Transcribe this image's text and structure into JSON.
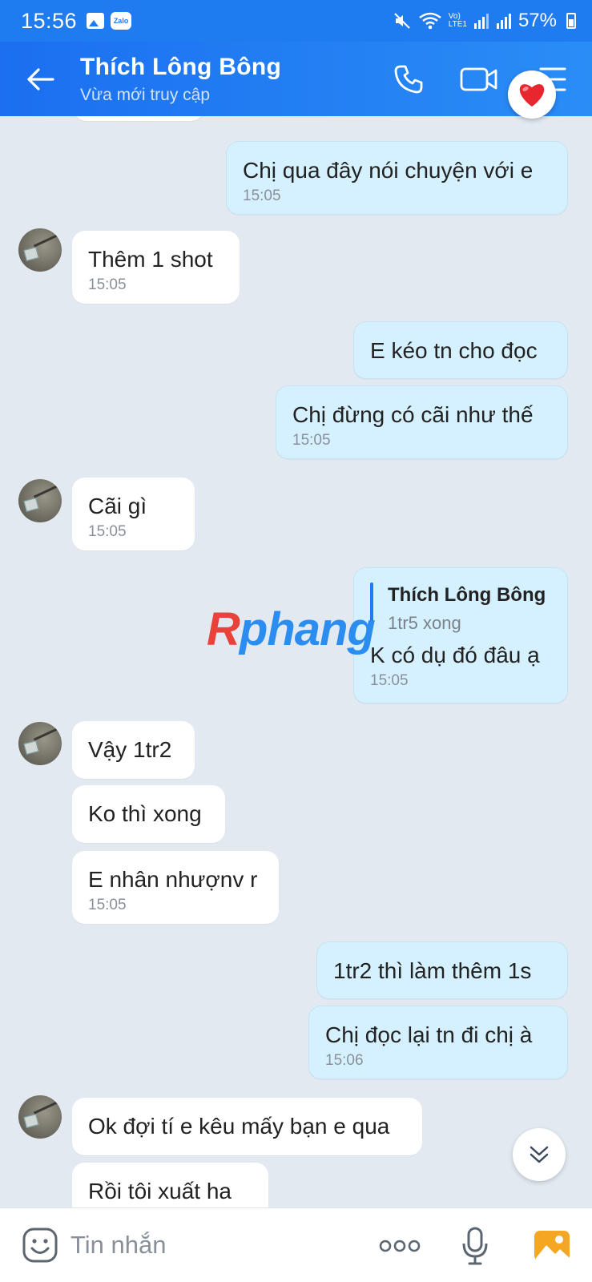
{
  "status_bar": {
    "time": "15:56",
    "battery": "57%",
    "lte_label": "LTE1",
    "volte_label": "Vo)",
    "zalo_label": "Zalo"
  },
  "header": {
    "contact_name": "Thích Lông Bông",
    "contact_status": "Vừa mới truy cập"
  },
  "watermark": {
    "r": "R",
    "rest": "phang"
  },
  "messages": [
    {
      "side": "out",
      "text": "Chị qua đây nói chuyện với e",
      "time": "15:05"
    },
    {
      "side": "in",
      "text": "Thêm 1 shot",
      "time": "15:05"
    },
    {
      "side": "out",
      "text": "E kéo tn cho đọc"
    },
    {
      "side": "out",
      "text": "Chị đừng có cãi như thế",
      "time": "15:05"
    },
    {
      "side": "in",
      "text": "Cãi gì",
      "time": "15:05"
    },
    {
      "side": "out",
      "quote_name": "Thích Lông Bông",
      "quote_text": "1tr5 xong",
      "text": "K có dụ đó đâu ạ",
      "time": "15:05"
    },
    {
      "side": "in",
      "text": "Vậy 1tr2"
    },
    {
      "side": "in",
      "text": "Ko thì xong"
    },
    {
      "side": "in",
      "text": "E nhân nhượnv r",
      "time": "15:05"
    },
    {
      "side": "out",
      "text": "1tr2 thì làm thêm 1s"
    },
    {
      "side": "out",
      "text": "Chị đọc lại tn đi chị à",
      "time": "15:06"
    },
    {
      "side": "in",
      "text": "Ok đợi tí e kêu mấy bạn e qua"
    },
    {
      "side": "in",
      "text": "Rồi tôi xuất ha"
    }
  ],
  "input": {
    "placeholder": "Tin nhắn"
  },
  "colors": {
    "header": "#1f7bf0",
    "outgoing_bubble": "#d5f1ff",
    "incoming_bubble": "#ffffff",
    "chat_bg": "#e2e9f1"
  },
  "icons": [
    "back-arrow-icon",
    "phone-icon",
    "video-call-icon",
    "menu-icon",
    "heart-icon",
    "sticker-icon",
    "more-options-icon",
    "microphone-icon",
    "gallery-icon",
    "chevron-down-icon"
  ]
}
